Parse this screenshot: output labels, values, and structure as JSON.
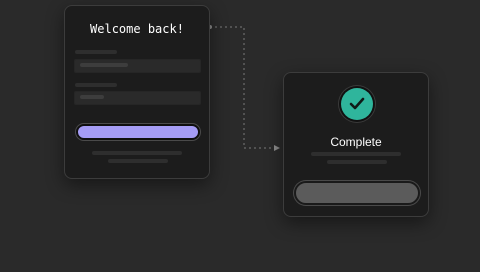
{
  "login": {
    "title": "Welcome back!"
  },
  "complete": {
    "title": "Complete"
  },
  "icons": {
    "status": "check-icon"
  },
  "colors": {
    "background": "#2a2a2a",
    "card": "#1c1c1c",
    "primary_button": "#a59cf5",
    "success": "#2fb59c",
    "secondary_button": "#5b5b5b",
    "connector": "#7a7a7a"
  }
}
